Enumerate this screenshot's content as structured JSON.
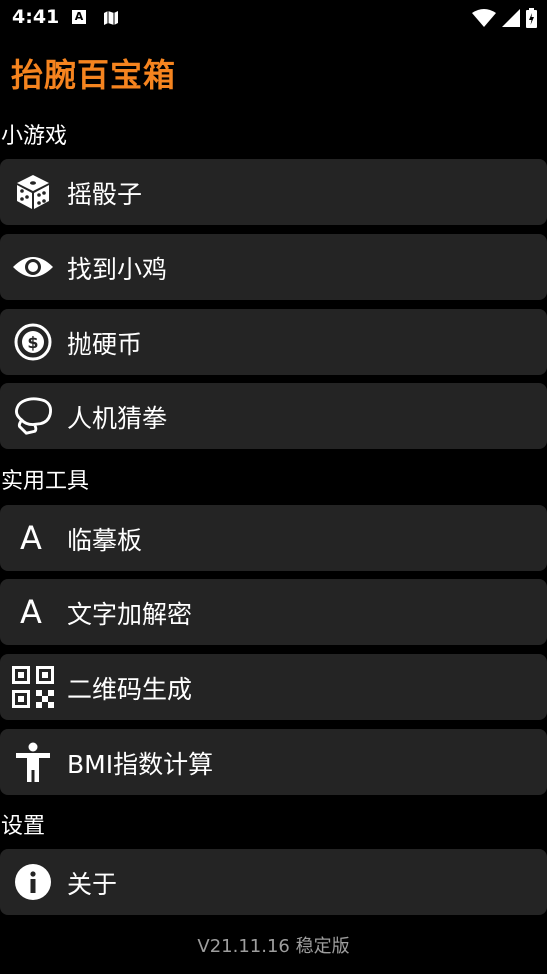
{
  "status_bar": {
    "time": "4:41",
    "a_badge": "A"
  },
  "app": {
    "title": "抬腕百宝箱",
    "accent_color": "#f5841f"
  },
  "sections": {
    "games": {
      "header": "小游戏",
      "items": [
        {
          "label": "摇骰子",
          "icon": "dice-icon"
        },
        {
          "label": "找到小鸡",
          "icon": "eye-icon"
        },
        {
          "label": "抛硬币",
          "icon": "dollar-coin-icon"
        },
        {
          "label": "人机猜拳",
          "icon": "fist-icon"
        }
      ]
    },
    "tools": {
      "header": "实用工具",
      "items": [
        {
          "label": "临摹板",
          "icon": "letter-a-icon",
          "glyph": "A"
        },
        {
          "label": "文字加解密",
          "icon": "letter-a-icon",
          "glyph": "A"
        },
        {
          "label": "二维码生成",
          "icon": "qr-code-icon"
        },
        {
          "label": "BMI指数计算",
          "icon": "accessibility-icon"
        }
      ]
    },
    "settings": {
      "header": "设置",
      "items": [
        {
          "label": "关于",
          "icon": "info-icon"
        }
      ]
    }
  },
  "footer": {
    "version": "V21.11.16 稳定版"
  }
}
